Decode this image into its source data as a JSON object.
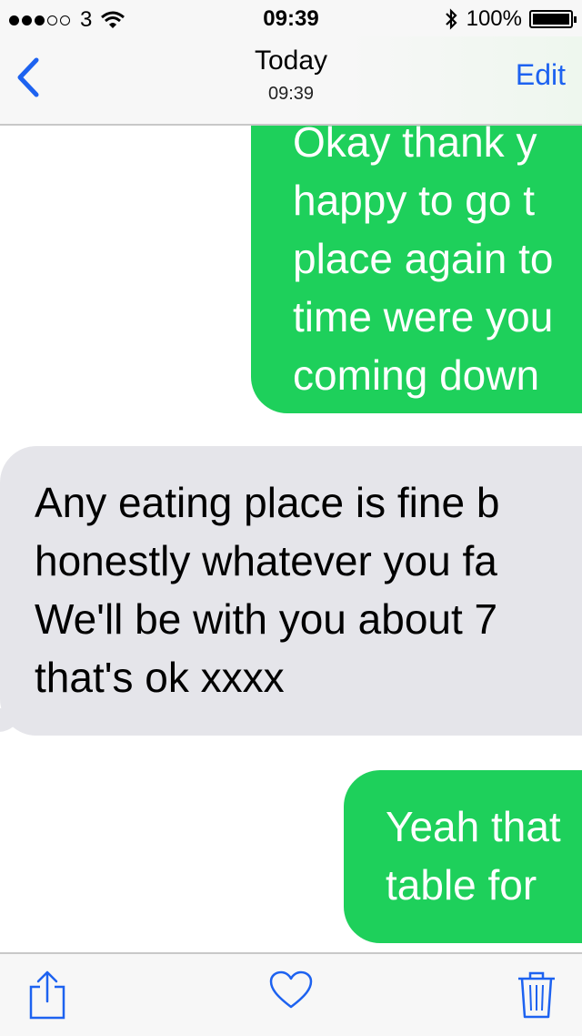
{
  "status_bar": {
    "carrier": "3",
    "time": "09:39",
    "battery_percent": "100%",
    "signal_bars_filled": 3,
    "signal_bars_total": 5
  },
  "nav": {
    "title": "Today",
    "subtitle": "09:39",
    "edit_label": "Edit"
  },
  "messages": [
    {
      "direction": "sent",
      "lines": [
        "Okay thank y",
        "happy to go t",
        "place again to",
        "time were you",
        "coming down"
      ]
    },
    {
      "direction": "received",
      "lines": [
        "Any eating place is fine b",
        "honestly whatever you fa",
        "We'll be with you about 7",
        "that's ok xxxx"
      ]
    },
    {
      "direction": "sent",
      "lines": [
        "Yeah that",
        "table for"
      ]
    }
  ],
  "toolbar": {
    "icons": [
      "share-icon",
      "heart-icon",
      "trash-icon"
    ]
  },
  "colors": {
    "accent": "#1d62f0",
    "sent_bubble": "#1ed05b",
    "received_bubble": "#e5e5ea"
  }
}
